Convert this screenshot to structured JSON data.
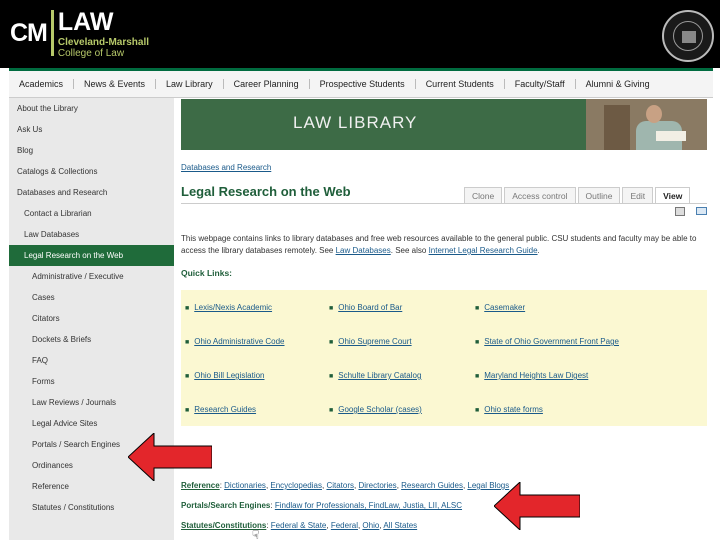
{
  "header": {
    "logo_cm": "CM",
    "logo_law": "LAW",
    "logo_line1": "Cleveland-Marshall",
    "logo_line2": "College of Law"
  },
  "nav": [
    "Academics",
    "News & Events",
    "Law Library",
    "Career Planning",
    "Prospective Students",
    "Current Students",
    "Faculty/Staff",
    "Alumni & Giving"
  ],
  "sidebar": [
    {
      "label": "About the Library",
      "level": 1
    },
    {
      "label": "Ask Us",
      "level": 1
    },
    {
      "label": "Blog",
      "level": 1
    },
    {
      "label": "Catalogs & Collections",
      "level": 1
    },
    {
      "label": "Databases and Research",
      "level": 1
    },
    {
      "label": "Contact a Librarian",
      "level": 2
    },
    {
      "label": "Law Databases",
      "level": 2
    },
    {
      "label": "Legal Research on the Web",
      "level": 2,
      "active": true
    },
    {
      "label": "Administrative / Executive",
      "level": 3
    },
    {
      "label": "Cases",
      "level": 3
    },
    {
      "label": "Citators",
      "level": 3
    },
    {
      "label": "Dockets & Briefs",
      "level": 3
    },
    {
      "label": "FAQ",
      "level": 3
    },
    {
      "label": "Forms",
      "level": 3
    },
    {
      "label": "Law Reviews / Journals",
      "level": 3
    },
    {
      "label": "Legal Advice Sites",
      "level": 3
    },
    {
      "label": "Portals / Search Engines",
      "level": 3
    },
    {
      "label": "Ordinances",
      "level": 3
    },
    {
      "label": "Reference",
      "level": 3
    },
    {
      "label": "Statutes / Constitutions",
      "level": 3
    }
  ],
  "banner": {
    "title": "LAW LIBRARY"
  },
  "main": {
    "breadcrumb": "Databases and Research",
    "title": "Legal Research on the Web",
    "tabs": [
      "Clone",
      "Access control",
      "Outline",
      "Edit",
      "View"
    ],
    "intro_pre": "This webpage contains links to library databases and free web resources available to the general public. CSU students and faculty may be able to access the library databases remotely. See ",
    "intro_link1": "Law Databases",
    "intro_mid": ". See also ",
    "intro_link2": "Internet Legal Research Guide",
    "intro_post": ".",
    "quick_links_label": "Quick Links:",
    "quick_links": [
      "Lexis/Nexis Academic",
      "Ohio Board of Bar",
      "Casemaker",
      "Ohio Administrative Code",
      "Ohio Supreme Court",
      "State of Ohio Government Front Page",
      "Ohio Bill Legislation",
      "Schulte Library Catalog",
      "Maryland Heights Law Digest",
      "Research Guides",
      "Google Scholar (cases)",
      "Ohio state forms"
    ],
    "reference_label": "Reference",
    "reference_links": [
      "Dictionaries",
      "Encyclopedias",
      "Citators",
      "Directories",
      "Research Guides",
      "Legal Blogs"
    ],
    "portals_label": "Portals/Search Engines",
    "portals_text": "Findlaw for Professionals, FindLaw, Justia, LII, ALSC",
    "statutes_label": "Statutes/Constitutions",
    "statutes_links": [
      "Federal & State",
      "Federal",
      "Ohio",
      "All States"
    ]
  },
  "overlay_color": "#e3262b"
}
